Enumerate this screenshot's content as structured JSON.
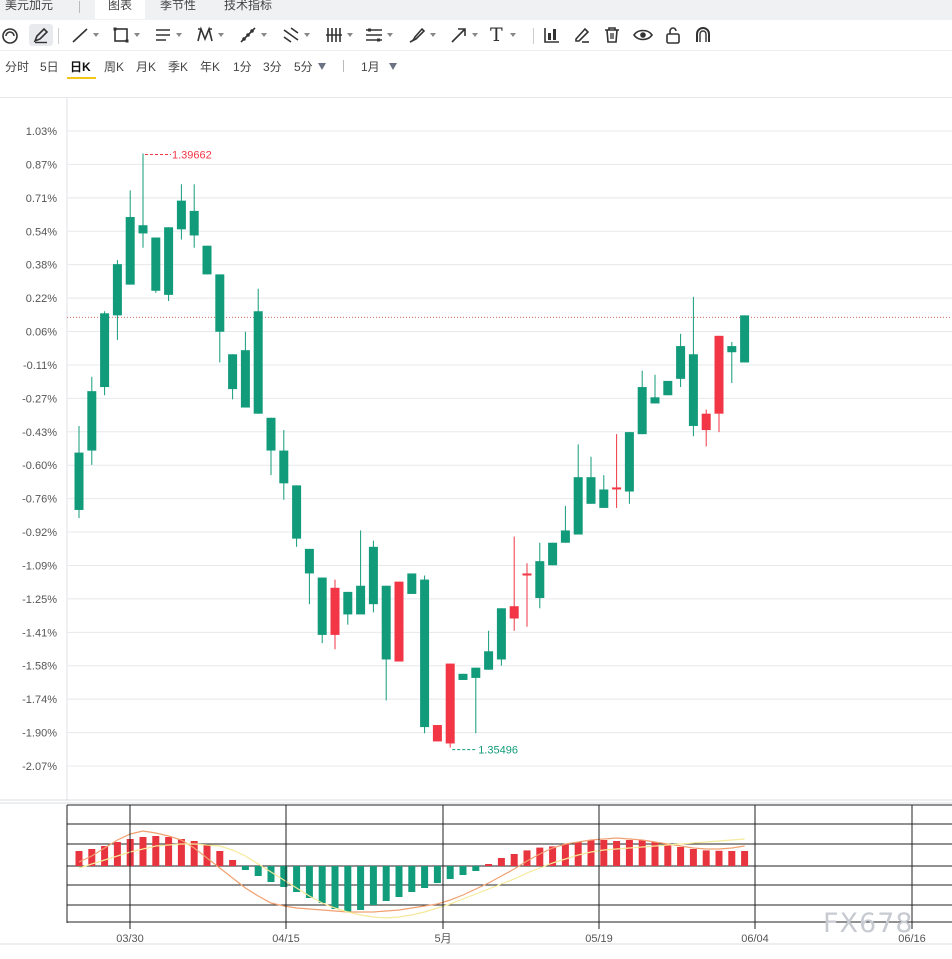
{
  "header": {
    "symbol_tab": "美元加元",
    "tabs": [
      {
        "label": "图表",
        "active": true
      },
      {
        "label": "季节性",
        "active": false
      },
      {
        "label": "技术指标",
        "active": false
      }
    ]
  },
  "toolbar": {
    "tools": [
      "chart-style-icon",
      "pencil-icon",
      "line-icon",
      "rectangle-icon",
      "parallel-lines-icon",
      "pattern-icon",
      "measure-icon",
      "fork-icon",
      "comb-icon",
      "hlines-icon",
      "brush-icon",
      "arrow-icon",
      "text-icon",
      "indicator-icon",
      "edit-icon",
      "trash-icon",
      "eye-icon",
      "lock-icon",
      "magnet-icon"
    ],
    "text_tool_label": "T"
  },
  "periods": {
    "items": [
      "分时",
      "5日",
      "日K",
      "周K",
      "月K",
      "季K",
      "年K",
      "1分",
      "3分",
      "5分"
    ],
    "active": "日K",
    "range": "1月"
  },
  "colors": {
    "up": "#f23645",
    "down": "#129b7a",
    "axis_text": "#555555",
    "grid": "#e6e8eb",
    "macd_up": "#e8343f",
    "macd_down": "#119c7b",
    "dif_line": "#f0a070",
    "dea_line": "#f5e99a"
  },
  "chart_data": [
    {
      "type": "candlestick",
      "yaxis_unit": "%",
      "ylabels": [
        "1.03%",
        "0.87%",
        "0.71%",
        "0.54%",
        "0.38%",
        "0.22%",
        "0.06%",
        "-0.11%",
        "-0.27%",
        "-0.43%",
        "-0.60%",
        "-0.76%",
        "-0.92%",
        "-1.09%",
        "-1.25%",
        "-1.41%",
        "-1.58%",
        "-1.74%",
        "-1.90%",
        "-2.07%"
      ],
      "ylim": [
        -2.07,
        1.03
      ],
      "high_label": "1.39662",
      "low_label": "1.35496",
      "current_level_pct": 0.12,
      "candles": [
        [
          -0.54,
          -0.82,
          -0.41,
          -0.86
        ],
        [
          -0.24,
          -0.53,
          -0.17,
          -0.6
        ],
        [
          0.14,
          -0.22,
          0.15,
          -0.26
        ],
        [
          0.38,
          0.13,
          0.4,
          0.01
        ],
        [
          0.61,
          0.28,
          0.74,
          0.28
        ],
        [
          0.57,
          0.53,
          0.92,
          0.46
        ],
        [
          0.51,
          0.25,
          0.51,
          0.24
        ],
        [
          0.56,
          0.23,
          0.56,
          0.2
        ],
        [
          0.69,
          0.55,
          0.77,
          0.5
        ],
        [
          0.64,
          0.52,
          0.77,
          0.46
        ],
        [
          0.47,
          0.33,
          0.47,
          0.33
        ],
        [
          0.33,
          0.05,
          0.33,
          -0.1
        ],
        [
          -0.06,
          -0.23,
          -0.06,
          -0.28
        ],
        [
          -0.04,
          -0.32,
          0.05,
          -0.32
        ],
        [
          0.15,
          -0.35,
          0.26,
          -0.35
        ],
        [
          -0.37,
          -0.53,
          -0.37,
          -0.65
        ],
        [
          -0.53,
          -0.69,
          -0.43,
          -0.77
        ],
        [
          -0.7,
          -0.96,
          -0.7,
          -1.0
        ],
        [
          -1.01,
          -1.13,
          -1.01,
          -1.28
        ],
        [
          -1.15,
          -1.43,
          -1.15,
          -1.47
        ],
        [
          -1.43,
          -1.2,
          -1.16,
          -1.5
        ],
        [
          -1.22,
          -1.33,
          -1.22,
          -1.38
        ],
        [
          -1.19,
          -1.33,
          -0.92,
          -1.3
        ],
        [
          -1.0,
          -1.28,
          -0.97,
          -1.32
        ],
        [
          -1.19,
          -1.55,
          -1.19,
          -1.75
        ],
        [
          -1.56,
          -1.17,
          -1.17,
          -1.56
        ],
        [
          -1.13,
          -1.23,
          -1.13,
          -1.23
        ],
        [
          -1.16,
          -1.88,
          -1.14,
          -1.91
        ],
        [
          -1.95,
          -1.87,
          -1.87,
          -1.95
        ],
        [
          -1.96,
          -1.57,
          -1.57,
          -1.98
        ],
        [
          -1.62,
          -1.65,
          -1.62,
          -1.65
        ],
        [
          -1.59,
          -1.64,
          -1.59,
          -1.91
        ],
        [
          -1.51,
          -1.6,
          -1.41,
          -1.6
        ],
        [
          -1.3,
          -1.55,
          -1.3,
          -1.58
        ],
        [
          -1.35,
          -1.29,
          -0.95,
          -1.41
        ],
        [
          -1.14,
          -1.13,
          -1.08,
          -1.39
        ],
        [
          -1.07,
          -1.25,
          -0.98,
          -1.3
        ],
        [
          -0.98,
          -1.09,
          -0.98,
          -1.09
        ],
        [
          -0.92,
          -0.98,
          -0.8,
          -0.98
        ],
        [
          -0.66,
          -0.94,
          -0.5,
          -0.94
        ],
        [
          -0.66,
          -0.79,
          -0.56,
          -0.79
        ],
        [
          -0.72,
          -0.81,
          -0.65,
          -0.81
        ],
        [
          -0.72,
          -0.71,
          -0.45,
          -0.81
        ],
        [
          -0.44,
          -0.73,
          -0.44,
          -0.79
        ],
        [
          -0.22,
          -0.45,
          -0.14,
          -0.45
        ],
        [
          -0.27,
          -0.3,
          -0.16,
          -0.3
        ],
        [
          -0.19,
          -0.26,
          -0.21,
          -0.26
        ],
        [
          -0.02,
          -0.18,
          0.04,
          -0.22
        ],
        [
          -0.06,
          -0.41,
          0.22,
          -0.46
        ],
        [
          -0.43,
          -0.35,
          -0.33,
          -0.51
        ],
        [
          -0.35,
          0.03,
          0.03,
          -0.44
        ],
        [
          -0.02,
          -0.05,
          0.0,
          -0.2
        ],
        [
          0.13,
          -0.1,
          0.13,
          -0.1
        ]
      ]
    },
    {
      "type": "bar",
      "name": "MACD",
      "values": [
        0.75,
        0.85,
        1.0,
        1.2,
        1.35,
        1.45,
        1.5,
        1.45,
        1.35,
        1.25,
        1.05,
        0.75,
        0.3,
        -0.2,
        -0.5,
        -0.8,
        -1.05,
        -1.3,
        -1.6,
        -1.85,
        -2.15,
        -2.3,
        -2.2,
        -1.95,
        -1.75,
        -1.55,
        -1.3,
        -1.1,
        -0.85,
        -0.65,
        -0.45,
        -0.25,
        0.1,
        0.4,
        0.6,
        0.78,
        0.92,
        0.98,
        1.1,
        1.2,
        1.3,
        1.3,
        1.25,
        1.3,
        1.3,
        1.2,
        1.1,
        0.95,
        0.85,
        0.78,
        0.76,
        0.75,
        0.75
      ],
      "dif_line": [
        0.2,
        0.5,
        0.9,
        1.3,
        1.6,
        1.75,
        1.65,
        1.5,
        1.3,
        0.9,
        0.4,
        -0.1,
        -0.6,
        -1.1,
        -1.5,
        -1.85,
        -2.0,
        -2.1,
        -2.15,
        -2.2,
        -2.25,
        -2.3,
        -2.3,
        -2.3,
        -2.25,
        -2.2,
        -2.1,
        -2.0,
        -1.9,
        -1.7,
        -1.45,
        -1.15,
        -0.85,
        -0.5,
        -0.15,
        0.25,
        0.6,
        0.9,
        1.1,
        1.2,
        1.3,
        1.35,
        1.4,
        1.35,
        1.3,
        1.2,
        1.1,
        1.0,
        0.9,
        0.85,
        0.85,
        0.9,
        1.0
      ],
      "dea_line": [
        -0.1,
        0.1,
        0.3,
        0.5,
        0.7,
        0.85,
        1.0,
        1.05,
        1.1,
        1.1,
        1.05,
        1.0,
        0.8,
        0.5,
        0.1,
        -0.3,
        -0.7,
        -1.1,
        -1.5,
        -1.85,
        -2.1,
        -2.3,
        -2.45,
        -2.55,
        -2.6,
        -2.55,
        -2.45,
        -2.3,
        -2.1,
        -1.9,
        -1.65,
        -1.4,
        -1.15,
        -0.9,
        -0.65,
        -0.35,
        -0.1,
        0.15,
        0.35,
        0.55,
        0.7,
        0.8,
        0.85,
        0.9,
        0.95,
        1.0,
        1.05,
        1.1,
        1.15,
        1.2,
        1.25,
        1.3,
        1.35
      ],
      "xlabels": [
        "03/30",
        "04/15",
        "5月",
        "05/19",
        "06/04",
        "06/16"
      ]
    }
  ],
  "watermark": "FX678"
}
